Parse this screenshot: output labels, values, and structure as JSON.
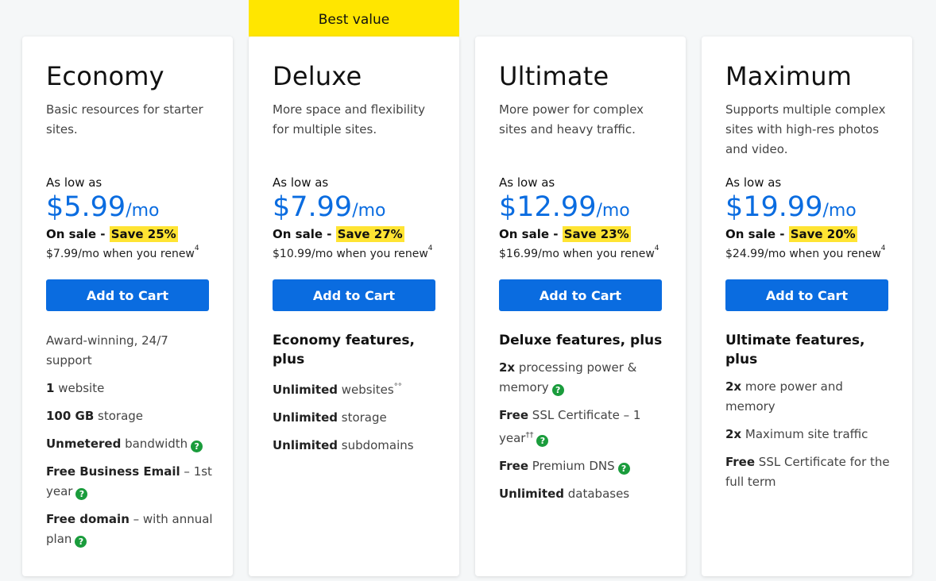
{
  "banner": {
    "label": "Best value"
  },
  "plans": [
    {
      "name": "Economy",
      "desc": "Basic resources for starter sites.",
      "as_low": "As low as",
      "price": "$5.99",
      "per": "/mo",
      "sale_label": "On sale -",
      "save": "Save 25%",
      "renew": "$7.99/mo when you renew",
      "renew_note": "4",
      "cart": "Add to Cart",
      "features": [
        {
          "bold": "",
          "text": "Award-winning, 24/7 support",
          "sup": "",
          "help": false
        },
        {
          "bold": "1",
          "text": " website",
          "sup": "",
          "help": false
        },
        {
          "bold": "100 GB",
          "text": " storage",
          "sup": "",
          "help": false
        },
        {
          "bold": "Unmetered",
          "text": " bandwidth",
          "sup": "",
          "help": true
        },
        {
          "bold": "Free Business Email",
          "text": " – 1st year",
          "sup": "",
          "help": true
        },
        {
          "bold": "Free domain",
          "text": " – with annual plan",
          "sup": "",
          "help": true
        }
      ]
    },
    {
      "name": "Deluxe",
      "desc": "More space and flexibility for multiple sites.",
      "as_low": "As low as",
      "price": "$7.99",
      "per": "/mo",
      "sale_label": "On sale -",
      "save": "Save 27%",
      "renew": "$10.99/mo when you renew",
      "renew_note": "4",
      "cart": "Add to Cart",
      "features_head": "Economy features, plus",
      "features": [
        {
          "bold": "Unlimited",
          "text": " websites",
          "sup": "°°",
          "help": false
        },
        {
          "bold": "Unlimited",
          "text": " storage",
          "sup": "",
          "help": false
        },
        {
          "bold": "Unlimited",
          "text": " subdomains",
          "sup": "",
          "help": false
        }
      ]
    },
    {
      "name": "Ultimate",
      "desc": "More power for complex sites and heavy traffic.",
      "as_low": "As low as",
      "price": "$12.99",
      "per": "/mo",
      "sale_label": "On sale -",
      "save": "Save 23%",
      "renew": "$16.99/mo when you renew",
      "renew_note": "4",
      "cart": "Add to Cart",
      "features_head": "Deluxe features, plus",
      "features": [
        {
          "bold": "2x",
          "text": " processing power & memory",
          "sup": "",
          "help": true
        },
        {
          "bold": "Free",
          "text": " SSL Certificate – 1 year",
          "sup": "††",
          "help": true
        },
        {
          "bold": "Free",
          "text": " Premium DNS",
          "sup": "",
          "help": true
        },
        {
          "bold": "Unlimited",
          "text": " databases",
          "sup": "",
          "help": false
        }
      ]
    },
    {
      "name": "Maximum",
      "desc": "Supports multiple complex sites with high-res photos and video.",
      "as_low": "As low as",
      "price": "$19.99",
      "per": "/mo",
      "sale_label": "On sale -",
      "save": "Save 20%",
      "renew": "$24.99/mo when you renew",
      "renew_note": "4",
      "cart": "Add to Cart",
      "features_head": "Ultimate features, plus",
      "features": [
        {
          "bold": "2x",
          "text": " more power and memory",
          "sup": "",
          "help": false
        },
        {
          "bold": "2x",
          "text": " Maximum site traffic",
          "sup": "",
          "help": false
        },
        {
          "bold": "Free",
          "text": " SSL Certificate for the full term",
          "sup": "",
          "help": false
        }
      ]
    }
  ],
  "help_icon": {
    "glyph": "?",
    "color": "#1a9c3c"
  },
  "colors": {
    "accent": "#0a6ce0",
    "highlight": "#ffe433",
    "banner": "#ffe600"
  }
}
